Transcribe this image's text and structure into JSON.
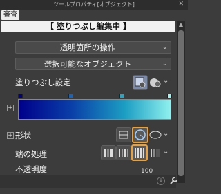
{
  "window": {
    "title": "ツールプロパティ[オブジェクト]",
    "close": "✕"
  },
  "tab_tag": "審査",
  "header": "【 塗りつぶし編集中 】",
  "dropdowns": [
    {
      "label": "透明箇所の操作"
    },
    {
      "label": "選択可能なオブジェクト"
    }
  ],
  "fill_settings": {
    "label": "塗りつぶし設定"
  },
  "gradient": {
    "stops": [
      "#00008b",
      "#1565c0",
      "#22a8c6",
      "#9af4f0"
    ]
  },
  "shape": {
    "label": "形状"
  },
  "end_processing": {
    "label": "端の処理"
  },
  "opacity": {
    "label": "不透明度",
    "value": "100"
  },
  "icons": {
    "close": "close-icon",
    "scroll_up": "scroll-up-icon",
    "expand": "plus-icon",
    "settings": "wrench-icon",
    "reset": "reset-icon"
  }
}
